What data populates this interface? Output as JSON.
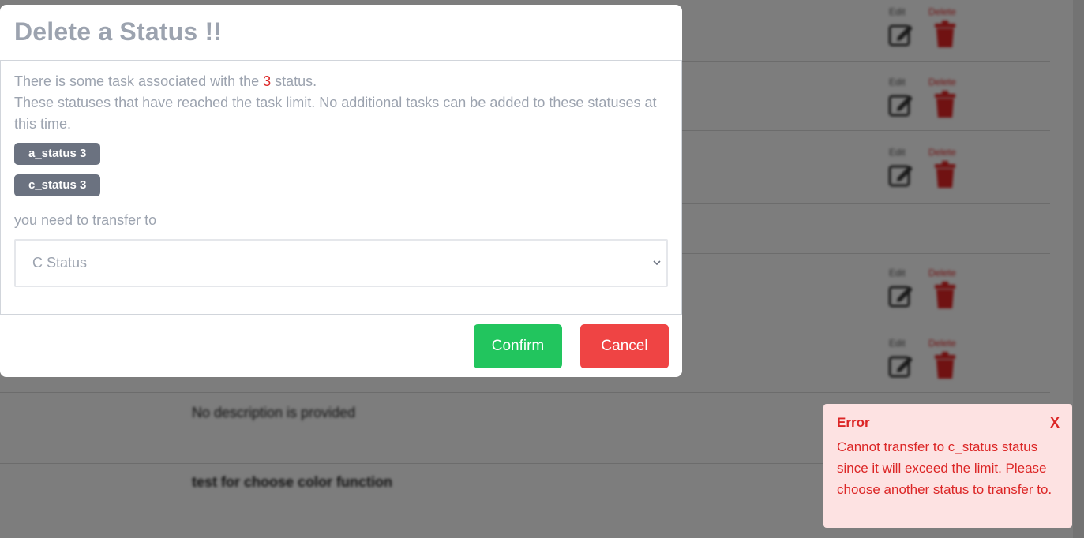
{
  "background": {
    "row_actions": [
      {
        "edit_label": "Edit",
        "delete_label": "Delete"
      },
      {
        "edit_label": "Edit",
        "delete_label": "Delete"
      },
      {
        "edit_label": "Edit",
        "delete_label": "Delete"
      },
      {
        "edit_label": "Edit",
        "delete_label": "Delete"
      },
      {
        "edit_label": "Edit",
        "delete_label": "Delete"
      }
    ],
    "descriptions": [
      "No description is provided",
      "test for choose color function"
    ]
  },
  "modal": {
    "title": "Delete a Status !!",
    "intro_prefix": "There is some task associated with the ",
    "task_count": "3",
    "intro_suffix": " status.",
    "limit_message": "These statuses that have reached the task limit. No additional tasks can be added to these statuses at this time.",
    "badges": [
      "a_status 3",
      "c_status 3"
    ],
    "transfer_label": "you need to transfer to",
    "selected_status": "C Status",
    "confirm_label": "Confirm",
    "cancel_label": "Cancel"
  },
  "toast": {
    "title": "Error",
    "close_label": "X",
    "message": "Cannot transfer to c_status status since it will exceed the limit. Please choose another status to transfer to."
  },
  "colors": {
    "confirm": "#22c55e",
    "cancel": "#ef4444",
    "error_bg": "#fde2e2",
    "error_text": "#dc2626",
    "badge": "#6b7280"
  }
}
